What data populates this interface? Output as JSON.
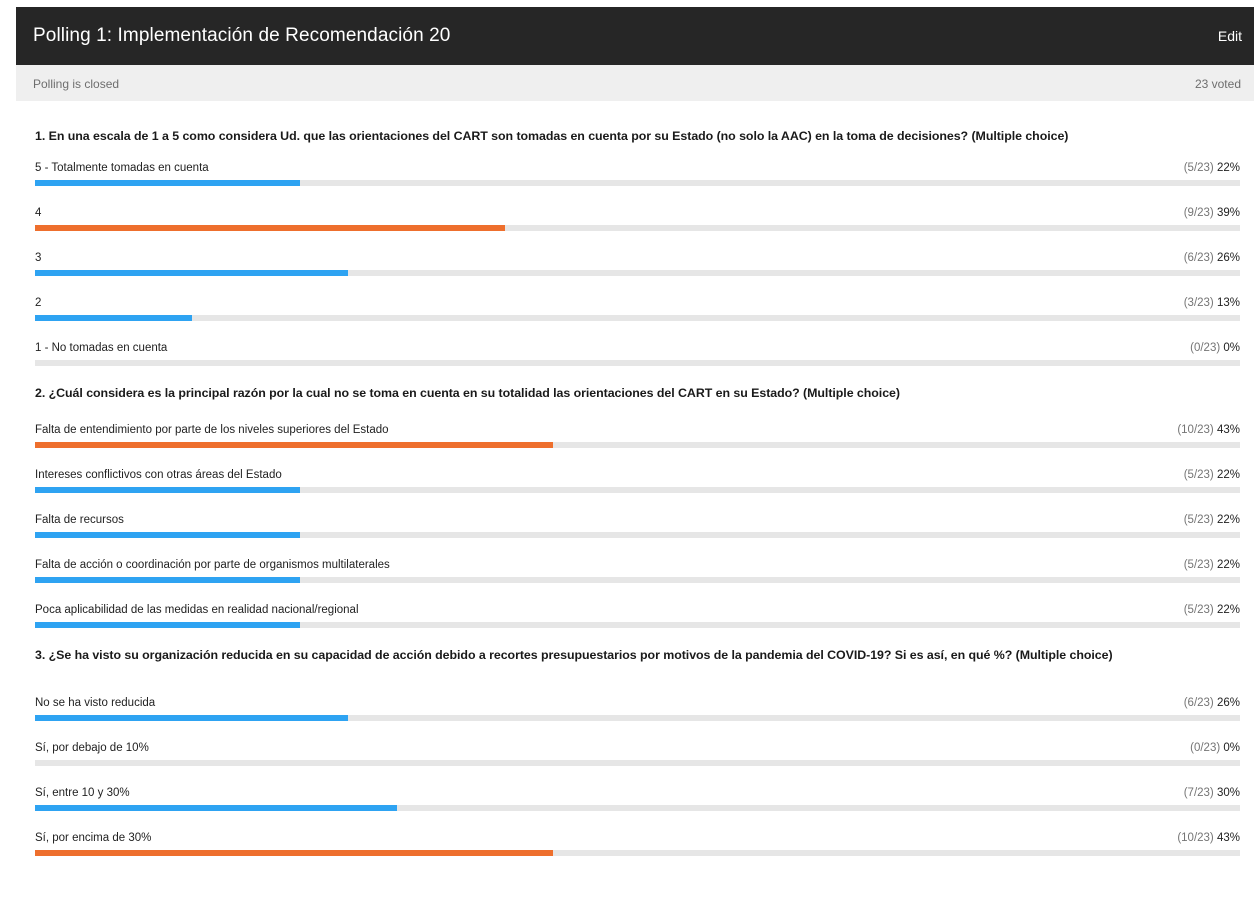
{
  "header": {
    "title": "Polling 1: Implementación de Recomendación 20",
    "edit_label": "Edit"
  },
  "status": {
    "state": "Polling is closed",
    "voted": "23 voted"
  },
  "colors": {
    "header_bg": "#262626",
    "status_bg": "#efefef",
    "bar_normal": "#2ea3f2",
    "bar_top": "#ee6f2d",
    "track": "#e6e6e6"
  },
  "questions": [
    {
      "text": "1. En una escala de 1 a 5 como considera Ud. que las orientaciones del CART son tomadas en cuenta por su Estado (no solo la AAC) en la toma de decisiones? (Multiple choice)",
      "options": [
        {
          "label": "5 - Totalmente tomadas en cuenta",
          "count": "(5/23)",
          "percent": "22%",
          "value": 0.22,
          "top": false
        },
        {
          "label": "4",
          "count": "(9/23)",
          "percent": "39%",
          "value": 0.39,
          "top": true
        },
        {
          "label": "3",
          "count": "(6/23)",
          "percent": "26%",
          "value": 0.26,
          "top": false
        },
        {
          "label": "2",
          "count": "(3/23)",
          "percent": "13%",
          "value": 0.13,
          "top": false
        },
        {
          "label": "1 - No tomadas en cuenta",
          "count": "(0/23)",
          "percent": "0%",
          "value": 0.0,
          "top": false
        }
      ]
    },
    {
      "text": "2. ¿Cuál considera es la principal razón por la cual no se toma en cuenta en su totalidad las orientaciones del CART en su Estado? (Multiple choice)",
      "options": [
        {
          "label": "Falta de entendimiento por parte de los niveles superiores del Estado",
          "count": "(10/23)",
          "percent": "43%",
          "value": 0.43,
          "top": true
        },
        {
          "label": "Intereses conflictivos con otras áreas del Estado",
          "count": "(5/23)",
          "percent": "22%",
          "value": 0.22,
          "top": false
        },
        {
          "label": "Falta de recursos",
          "count": "(5/23)",
          "percent": "22%",
          "value": 0.22,
          "top": false
        },
        {
          "label": "Falta de acción o coordinación  por parte de organismos multilaterales",
          "count": "(5/23)",
          "percent": "22%",
          "value": 0.22,
          "top": false
        },
        {
          "label": "Poca aplicabilidad de las medidas en realidad nacional/regional",
          "count": "(5/23)",
          "percent": "22%",
          "value": 0.22,
          "top": false
        }
      ]
    },
    {
      "text": "3. ¿Se ha visto su organización reducida en su capacidad de acción debido a recortes presupuestarios por motivos de la pandemia del COVID-19? Si es así, en qué %? (Multiple choice)",
      "options": [
        {
          "label": "No se ha visto reducida",
          "count": "(6/23)",
          "percent": "26%",
          "value": 0.26,
          "top": false
        },
        {
          "label": "Sí, por debajo de 10%",
          "count": "(0/23)",
          "percent": "0%",
          "value": 0.0,
          "top": false
        },
        {
          "label": "Sí, entre 10 y 30%",
          "count": "(7/23)",
          "percent": "30%",
          "value": 0.3,
          "top": false
        },
        {
          "label": "Sí, por encima de 30%",
          "count": "(10/23)",
          "percent": "43%",
          "value": 0.43,
          "top": true
        }
      ]
    }
  ]
}
